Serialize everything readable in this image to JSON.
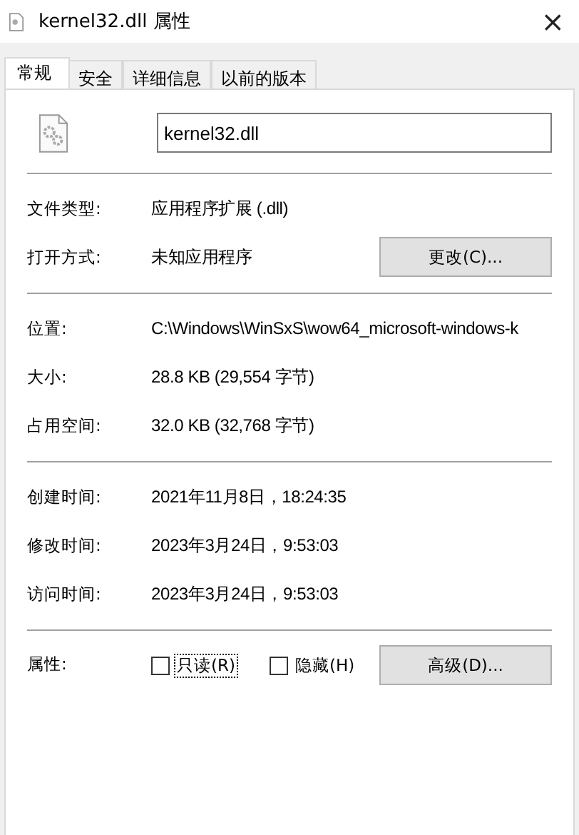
{
  "window": {
    "title": "kernel32.dll 属性",
    "close": "×"
  },
  "tabs": [
    {
      "label": "常规",
      "selected": true
    },
    {
      "label": "安全",
      "selected": false
    },
    {
      "label": "详细信息",
      "selected": false
    },
    {
      "label": "以前的版本",
      "selected": false
    }
  ],
  "file_name": "kernel32.dll",
  "sections": [
    [
      {
        "label": "文件类型:",
        "value": "应用程序扩展 (.dll)"
      },
      {
        "label": "打开方式:",
        "value": "未知应用程序",
        "button": "更改(C)..."
      }
    ],
    [
      {
        "label": "位置:",
        "value": "C:\\Windows\\WinSxS\\wow64_microsoft-windows-k"
      },
      {
        "label": "大小:",
        "value": "28.8 KB (29,554 字节)"
      },
      {
        "label": "占用空间:",
        "value": "32.0 KB (32,768 字节)"
      }
    ],
    [
      {
        "label": "创建时间:",
        "value": "2021年11月8日，18:24:35"
      },
      {
        "label": "修改时间:",
        "value": "2023年3月24日，9:53:03"
      },
      {
        "label": "访问时间:",
        "value": "2023年3月24日，9:53:03"
      }
    ]
  ],
  "attributes": {
    "label": "属性:",
    "checkboxes": [
      {
        "label": "只读(R)",
        "checked": false,
        "focused": true
      },
      {
        "label": "隐藏(H)",
        "checked": false,
        "focused": false
      }
    ],
    "button": "高级(D)..."
  }
}
